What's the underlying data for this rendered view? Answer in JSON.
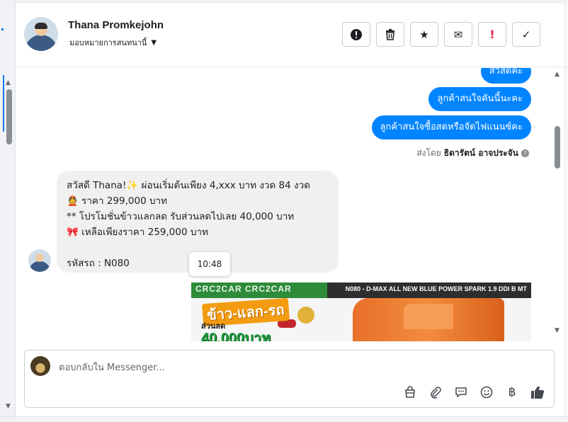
{
  "header": {
    "contact_name": "Thana Promkejohn",
    "assign_label": "มอบหมายการสนทนานี้",
    "toolbar": [
      {
        "name": "report-button",
        "glyph": "!",
        "icon": "alert-circle-icon"
      },
      {
        "name": "delete-button",
        "glyph": "",
        "icon": "trash-icon"
      },
      {
        "name": "star-button",
        "glyph": "★",
        "icon": "star-icon"
      },
      {
        "name": "mark-unread-button",
        "glyph": "✉",
        "icon": "envelope-icon"
      },
      {
        "name": "important-button",
        "glyph": "!",
        "icon": "exclamation-icon"
      },
      {
        "name": "done-button",
        "glyph": "✓",
        "icon": "check-icon"
      }
    ]
  },
  "messages": {
    "outgoing": [
      "สวัสดีค่ะ",
      "ลูกค้าสนใจคันนี้นะคะ",
      "ลูกค้าสนใจซื้อสดหรือจัดไฟแนนซ์คะ"
    ],
    "sent_by_label": "ส่งโดย",
    "sent_by_name": "ธิดารัตน์ อาจประจัน",
    "incoming": {
      "lines": [
        "สวัสดี Thana!✨  ผ่อนเริ่มต้นเพียง 4,xxx บาท งวด 84 งวด",
        "👲 ราคา 299,000 บาท",
        "** โปรโมชั่นข้าวแลกลด รับส่วนลดไปเลย 40,000 บาท",
        "🎀  เหลือเพียงราคา 259,000 บาท",
        "",
        "รหัสรถ : N080"
      ],
      "time": "10:48"
    },
    "promo_image": {
      "brand": "CRC2CAR CRC2CAR",
      "caption": "N080 - D-MAX ALL NEW BLUE POWER SPARK 1.9 DDI B MT",
      "headline": "ข้าว-แลก-รถ",
      "sub": "ส่วนลด",
      "discount": "40,000บาท"
    }
  },
  "composer": {
    "placeholder": "ตอบกลับใน Messenger...",
    "tools": [
      {
        "name": "shop-bag-icon",
        "glyph": "👜"
      },
      {
        "name": "attach-icon",
        "glyph": "📎"
      },
      {
        "name": "saved-reply-icon",
        "glyph": "💬"
      },
      {
        "name": "emoji-icon",
        "glyph": "☺"
      },
      {
        "name": "baht-icon",
        "glyph": "฿"
      },
      {
        "name": "like-icon",
        "glyph": "👍"
      }
    ]
  },
  "colors": {
    "outgoing_bubble": "#0084ff",
    "incoming_bubble": "#f0f0f0",
    "accent": "#1877f2"
  }
}
